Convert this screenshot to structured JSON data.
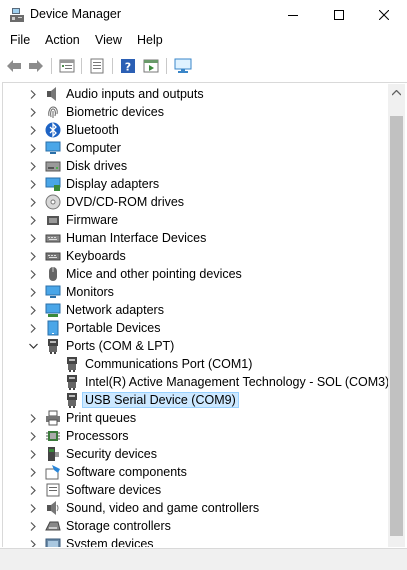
{
  "window": {
    "title": "Device Manager",
    "icon": "device-manager-icon"
  },
  "menu": [
    {
      "label": "File"
    },
    {
      "label": "Action"
    },
    {
      "label": "View"
    },
    {
      "label": "Help"
    }
  ],
  "toolbar": [
    {
      "icon": "back-arrow-icon"
    },
    {
      "icon": "forward-arrow-icon"
    },
    {
      "icon": "properties-icon"
    },
    {
      "icon": "show-hide-tree-icon"
    },
    {
      "icon": "help-icon"
    },
    {
      "icon": "run-icon"
    },
    {
      "icon": "monitor-icon"
    }
  ],
  "tree": {
    "items": [
      {
        "label": "Audio inputs and outputs",
        "icon": "speaker-icon",
        "expanded": false
      },
      {
        "label": "Biometric devices",
        "icon": "fingerprint-icon",
        "expanded": false
      },
      {
        "label": "Bluetooth",
        "icon": "bluetooth-icon",
        "expanded": false
      },
      {
        "label": "Computer",
        "icon": "computer-icon",
        "expanded": false
      },
      {
        "label": "Disk drives",
        "icon": "disk-drive-icon",
        "expanded": false
      },
      {
        "label": "Display adapters",
        "icon": "display-adapter-icon",
        "expanded": false
      },
      {
        "label": "DVD/CD-ROM drives",
        "icon": "dvd-icon",
        "expanded": false
      },
      {
        "label": "Firmware",
        "icon": "firmware-icon",
        "expanded": false
      },
      {
        "label": "Human Interface Devices",
        "icon": "hid-icon",
        "expanded": false
      },
      {
        "label": "Keyboards",
        "icon": "keyboard-icon",
        "expanded": false
      },
      {
        "label": "Mice and other pointing devices",
        "icon": "mouse-icon",
        "expanded": false
      },
      {
        "label": "Monitors",
        "icon": "monitor-icon",
        "expanded": false
      },
      {
        "label": "Network adapters",
        "icon": "network-icon",
        "expanded": false
      },
      {
        "label": "Portable Devices",
        "icon": "portable-device-icon",
        "expanded": false
      },
      {
        "label": "Ports (COM & LPT)",
        "icon": "port-icon",
        "expanded": true,
        "children": [
          {
            "label": "Communications Port (COM1)",
            "icon": "port-icon"
          },
          {
            "label": "Intel(R) Active Management Technology - SOL (COM3)",
            "icon": "port-icon"
          },
          {
            "label": "USB Serial Device (COM9)",
            "icon": "port-icon",
            "selected": true
          }
        ]
      },
      {
        "label": "Print queues",
        "icon": "printer-icon",
        "expanded": false
      },
      {
        "label": "Processors",
        "icon": "processor-icon",
        "expanded": false
      },
      {
        "label": "Security devices",
        "icon": "security-icon",
        "expanded": false
      },
      {
        "label": "Software components",
        "icon": "software-component-icon",
        "expanded": false
      },
      {
        "label": "Software devices",
        "icon": "software-device-icon",
        "expanded": false
      },
      {
        "label": "Sound, video and game controllers",
        "icon": "sound-icon",
        "expanded": false
      },
      {
        "label": "Storage controllers",
        "icon": "storage-icon",
        "expanded": false
      },
      {
        "label": "System devices",
        "icon": "system-icon",
        "expanded": false
      }
    ]
  },
  "colors": {
    "selection": "#cce8ff",
    "selection_border": "#99d1ff",
    "scroll_thumb": "#c1c1c1"
  }
}
